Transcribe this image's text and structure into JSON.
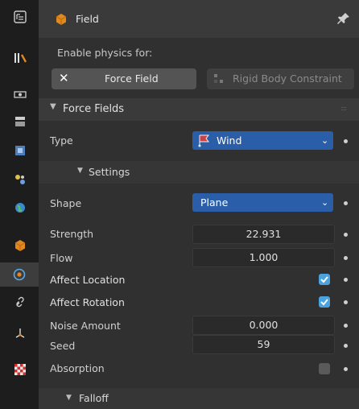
{
  "header": {
    "title": "Field"
  },
  "enable": {
    "label": "Enable physics for:",
    "force_field_button": "Force Field",
    "rigid_body_button": "Rigid Body Constraint"
  },
  "force_fields": {
    "title": "Force Fields",
    "type_label": "Type",
    "type_value": "Wind",
    "settings_title": "Settings",
    "shape_label": "Shape",
    "shape_value": "Plane",
    "strength_label": "Strength",
    "strength_value": "22.931",
    "flow_label": "Flow",
    "flow_value": "1.000",
    "affect_location_label": "Affect Location",
    "affect_location_checked": true,
    "affect_rotation_label": "Affect Rotation",
    "affect_rotation_checked": true,
    "noise_label": "Noise Amount",
    "noise_value": "0.000",
    "seed_label": "Seed",
    "seed_value": "59",
    "absorption_label": "Absorption",
    "absorption_checked": false,
    "falloff_title": "Falloff"
  },
  "colors": {
    "accent": "#2a5ea8",
    "checkbox_on": "#4aa3df",
    "orange": "#e0891e"
  },
  "icons": [
    "tool-icon",
    "render-icon",
    "output-icon",
    "view-layer-icon",
    "scene-icon",
    "world-icon",
    "object-icon",
    "physics-icon",
    "constraints-icon",
    "data-icon",
    "texture-icon",
    "pin-icon",
    "close-icon",
    "wind-icon",
    "chevron-down-icon"
  ]
}
